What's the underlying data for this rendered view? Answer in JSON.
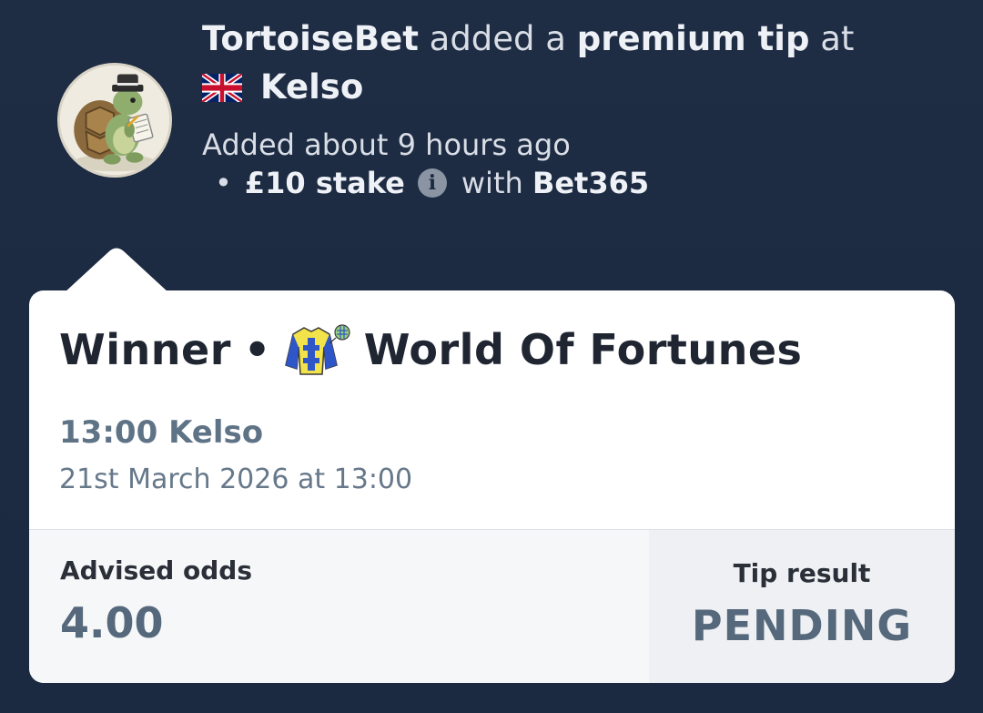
{
  "header": {
    "tipster": "TortoiseBet",
    "action_text": " added a ",
    "tip_kind": "premium tip",
    "at_text": " at",
    "venue": "Kelso",
    "added_time": "Added about 9 hours ago",
    "bullet": "•",
    "stake": "£10 stake",
    "with_text": "with",
    "bookmaker": "Bet365",
    "info_glyph": "i"
  },
  "icons": {
    "flag": "uk-flag-icon",
    "info": "info-icon",
    "silks": "jockey-silks-icon",
    "avatar": "tortoise-avatar"
  },
  "card": {
    "market": "Winner",
    "separator": "•",
    "selection": "World Of Fortunes",
    "race": "13:00 Kelso",
    "race_datetime": "21st March 2026 at 13:00",
    "odds_label": "Advised odds",
    "odds_value": "4.00",
    "result_label": "Tip result",
    "result_value": "PENDING"
  },
  "colors": {
    "background": "#1c2a40",
    "card": "#ffffff",
    "muted_text": "#5f7386",
    "silks_yellow": "#f2e34a",
    "silks_blue": "#2f56c9"
  }
}
